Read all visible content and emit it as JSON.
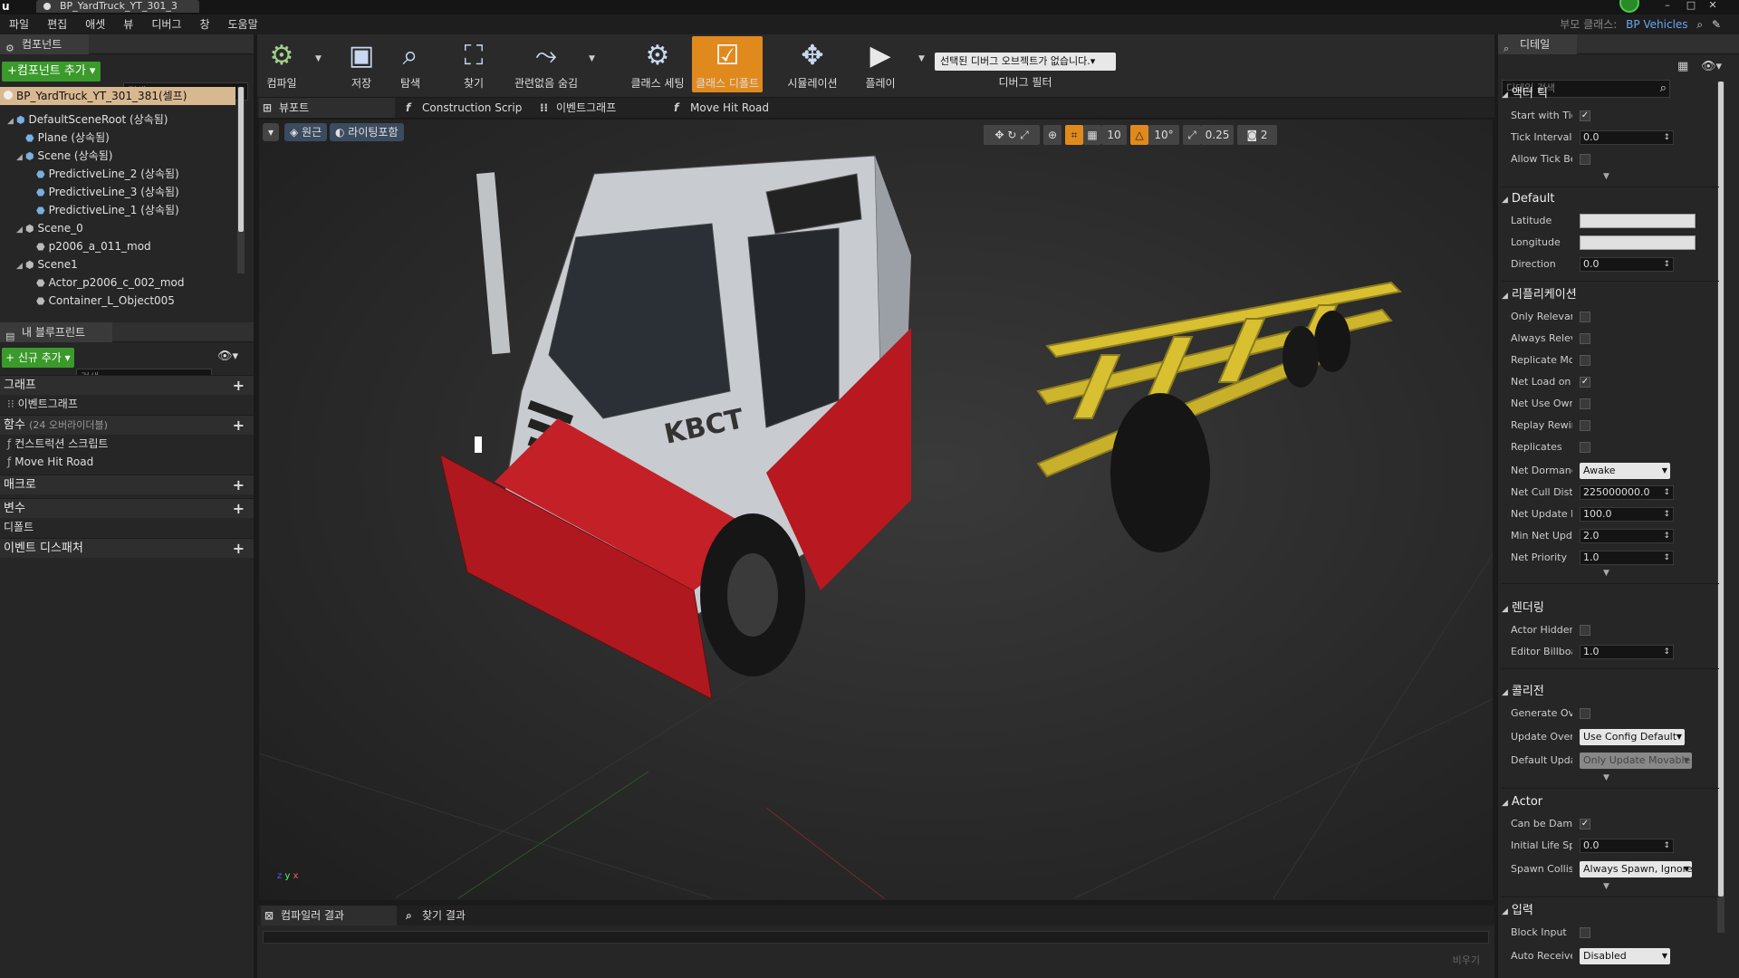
{
  "window": {
    "tab_title": "BP_YardTruck_YT_301_3",
    "parent_label": "부모 클래스:",
    "parent_value": "BP Vehicles"
  },
  "menu": [
    "파일",
    "편집",
    "애셋",
    "뷰",
    "디버그",
    "창",
    "도움말"
  ],
  "components": {
    "tab": "컴포넌트",
    "add_button": "+컴포넌트 추가 ▾",
    "search_placeholder": "검색",
    "root": "BP_YardTruck_YT_301_381(셀프)",
    "items": [
      "DefaultSceneRoot (상속됨)",
      "Plane (상속됨)",
      "Scene (상속됨)",
      "PredictiveLine_2 (상속됨)",
      "PredictiveLine_3 (상속됨)",
      "PredictiveLine_1 (상속됨)",
      "Scene_0",
      "p2006_a_011_mod",
      "Scene1",
      "Actor_p2006_c_002_mod",
      "Container_L_Object005"
    ]
  },
  "my_blueprint": {
    "tab": "내 블루프린트",
    "new_button": "+ 신규 추가 ▾",
    "search_placeholder": "검색",
    "sections": {
      "graphs": "그래프",
      "event_graph": "이벤트그래프",
      "functions": "함수",
      "functions_note": "(24 오버라이더블)",
      "construction_script": "컨스트럭션 스크립트",
      "move_hit_road": "Move Hit Road",
      "macros": "매크로",
      "variables": "변수",
      "default": "디폴트",
      "event_dispatchers": "이벤트 디스패처"
    }
  },
  "toolbar": {
    "compile": "컴파일",
    "save": "저장",
    "browse": "탐색",
    "find": "찾기",
    "hide_unrelated": "관련없음 숨김",
    "class_settings": "클래스 세팅",
    "class_defaults": "클래스 디폴트",
    "simulation": "시뮬레이션",
    "play": "플레이",
    "debug_select": "선택된 디버그 오브젝트가 없습니다.▾",
    "debug_filter": "디버그 필터"
  },
  "doc_tabs": [
    "뷰포트",
    "Construction Scrip",
    "이벤트그래프",
    "Move Hit Road"
  ],
  "viewport": {
    "perspective": "원근",
    "lighting": "라이팅포함",
    "grid_snap": "10",
    "rot_snap": "10°",
    "scale_snap": "0.25",
    "cam_speed": "2",
    "truck_text": "KBCT"
  },
  "bottom": {
    "tabs": [
      "컴파일러 결과",
      "찾기 결과"
    ],
    "clear": "비우기"
  },
  "details": {
    "tab": "디테일",
    "search_placeholder": "디테일 검색",
    "sections": {
      "actor_tick": {
        "title": "액터 틱",
        "start_with_tick": "Start with Tic",
        "tick_interval": "Tick Interval",
        "tick_interval_val": "0.0",
        "allow_tick": "Allow Tick Be"
      },
      "default": {
        "title": "Default",
        "latitude": "Latitude",
        "longitude": "Longitude",
        "direction": "Direction",
        "direction_val": "0.0"
      },
      "replication": {
        "title": "리플리케이션",
        "only_relevant": "Only Relevan",
        "always_relevant": "Always Relev",
        "replicate_movement": "Replicate Mo",
        "net_load": "Net Load on (",
        "net_use_owner": "Net Use Own",
        "replay_rewind": "Replay Rewin",
        "replicates": "Replicates",
        "net_dormancy": "Net Dormanc",
        "net_dormancy_val": "Awake",
        "net_cull": "Net Cull Distz",
        "net_cull_val": "225000000.0",
        "net_update": "Net Update Fr",
        "net_update_val": "100.0",
        "min_net_update": "Min Net Upda",
        "min_net_update_val": "2.0",
        "net_priority": "Net Priority",
        "net_priority_val": "1.0"
      },
      "rendering": {
        "title": "렌더링",
        "actor_hidden": "Actor Hidden",
        "editor_billboard": "Editor Billboa",
        "editor_billboard_val": "1.0"
      },
      "collision": {
        "title": "콜리전",
        "generate_overlap": "Generate Ove",
        "update_overlaps": "Update Overl",
        "update_overlaps_val": "Use Config Default",
        "default_update": "Default Updat",
        "default_update_val": "Only Update Movable"
      },
      "actor": {
        "title": "Actor",
        "can_be_damaged": "Can be Dama",
        "initial_life": "Initial Life Sp",
        "initial_life_val": "0.0",
        "spawn_collision": "Spawn Collisi",
        "spawn_collision_val": "Always Spawn, Ignore"
      },
      "input": {
        "title": "입력",
        "block_input": "Block Input",
        "auto_receive": "Auto Receive",
        "auto_receive_val": "Disabled"
      }
    }
  },
  "colors": {
    "accent_orange": "#e08a1e",
    "green_button": "#3a9a2a",
    "link_blue": "#68a8f0",
    "truck_red": "#b81820",
    "frame_yellow": "#d8c030"
  }
}
